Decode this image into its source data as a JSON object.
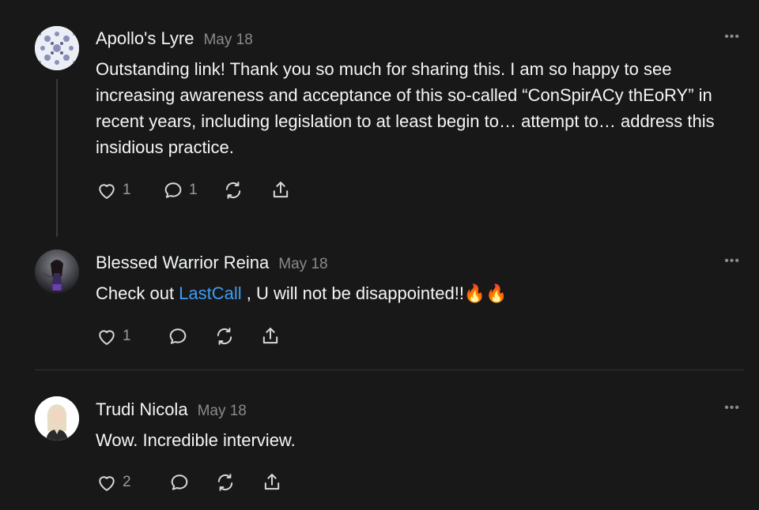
{
  "posts": [
    {
      "author": "Apollo's Lyre",
      "date": "May 18",
      "more": "•••",
      "text": "Outstanding link! Thank you so much for sharing this. I am so happy to see increasing awareness and acceptance of this so-called “ConSpirACy thEoRY” in recent years, including legislation to at least begin to… attempt to… address this insidious practice.",
      "likes": "1",
      "replies": "1"
    },
    {
      "author": "Blessed Warrior Reina",
      "date": "May 18",
      "more": "•••",
      "text_before": "Check out ",
      "link": "LastCall",
      "text_after": " , U will not be disappointed!!🔥🔥",
      "likes": "1"
    },
    {
      "author": "Trudi Nicola",
      "date": "May 18",
      "more": "•••",
      "text": "Wow. Incredible interview.",
      "likes": "2"
    }
  ],
  "icons": {
    "like": "heart-icon",
    "comment": "comment-icon",
    "repost": "repost-icon",
    "share": "share-icon",
    "more": "more-icon"
  },
  "colors": {
    "background": "#181818",
    "link": "#3d9cf5",
    "muted": "#8a8a8a"
  }
}
